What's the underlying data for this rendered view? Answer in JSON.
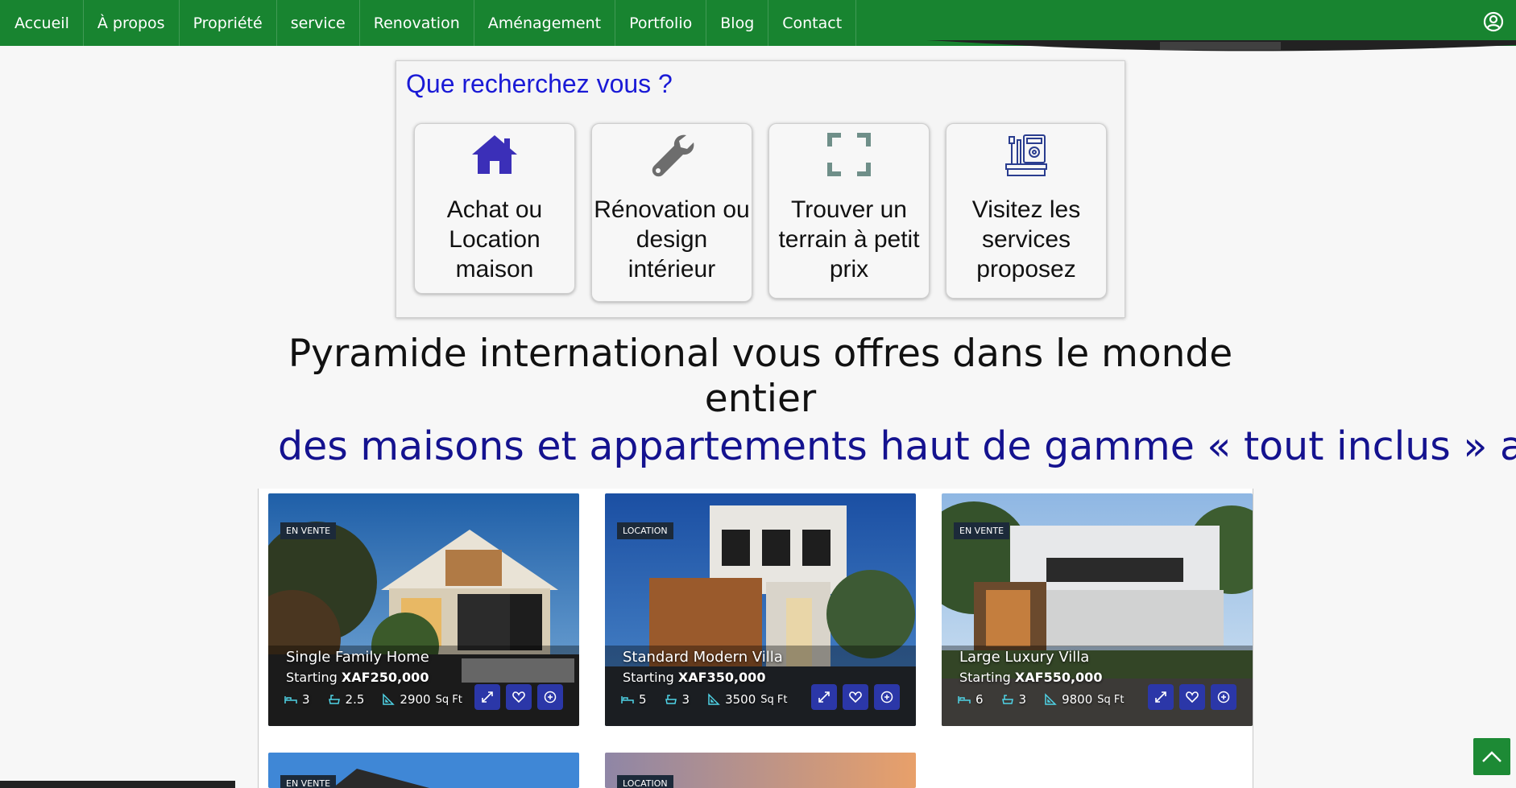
{
  "nav": {
    "items": [
      {
        "label": "Accueil"
      },
      {
        "label": "À propos"
      },
      {
        "label": "Propriété"
      },
      {
        "label": "service"
      },
      {
        "label": "Renovation"
      },
      {
        "label": "Aménagement"
      },
      {
        "label": "Portfolio"
      },
      {
        "label": "Blog"
      },
      {
        "label": "Contact"
      }
    ],
    "user_icon": "user-circle-icon"
  },
  "search": {
    "title": "Que recherchez vous ?",
    "cards": [
      {
        "label": "Achat ou Location maison",
        "icon": "house-icon",
        "color": "#3b2fb8"
      },
      {
        "label": "Rénovation ou design intérieur",
        "icon": "wrench-icon",
        "color": "#6d6d6d"
      },
      {
        "label": "Trouver un terrain à petit prix",
        "icon": "expand-frame-icon",
        "color": "#6f8f89"
      },
      {
        "label": "Visitez les services proposez",
        "icon": "tools-panel-icon",
        "color": "#2a3d8f"
      }
    ]
  },
  "headline": "Pyramide international vous offres dans le monde entier",
  "subheadline": "des maisons et appartements haut de gamme « tout inclus » add",
  "listings": [
    {
      "tag": "EN VENTE",
      "title": "Single Family Home",
      "price_prefix": "Starting",
      "price": "XAF250,000",
      "beds": "3",
      "baths": "2.5",
      "area": "2900",
      "area_unit": "Sq Ft"
    },
    {
      "tag": "LOCATION",
      "title": "Standard Modern Villa",
      "price_prefix": "Starting",
      "price": "XAF350,000",
      "beds": "5",
      "baths": "3",
      "area": "3500",
      "area_unit": "Sq Ft"
    },
    {
      "tag": "EN VENTE",
      "title": "Large Luxury Villa",
      "price_prefix": "Starting",
      "price": "XAF550,000",
      "beds": "6",
      "baths": "3",
      "area": "9800",
      "area_unit": "Sq Ft"
    },
    {
      "tag": "EN VENTE"
    },
    {
      "tag": "LOCATION"
    }
  ],
  "colors": {
    "nav": "#188430",
    "accent": "#2b37a8",
    "title_blue": "#1a1ad6",
    "sub_blue": "#14128f"
  }
}
